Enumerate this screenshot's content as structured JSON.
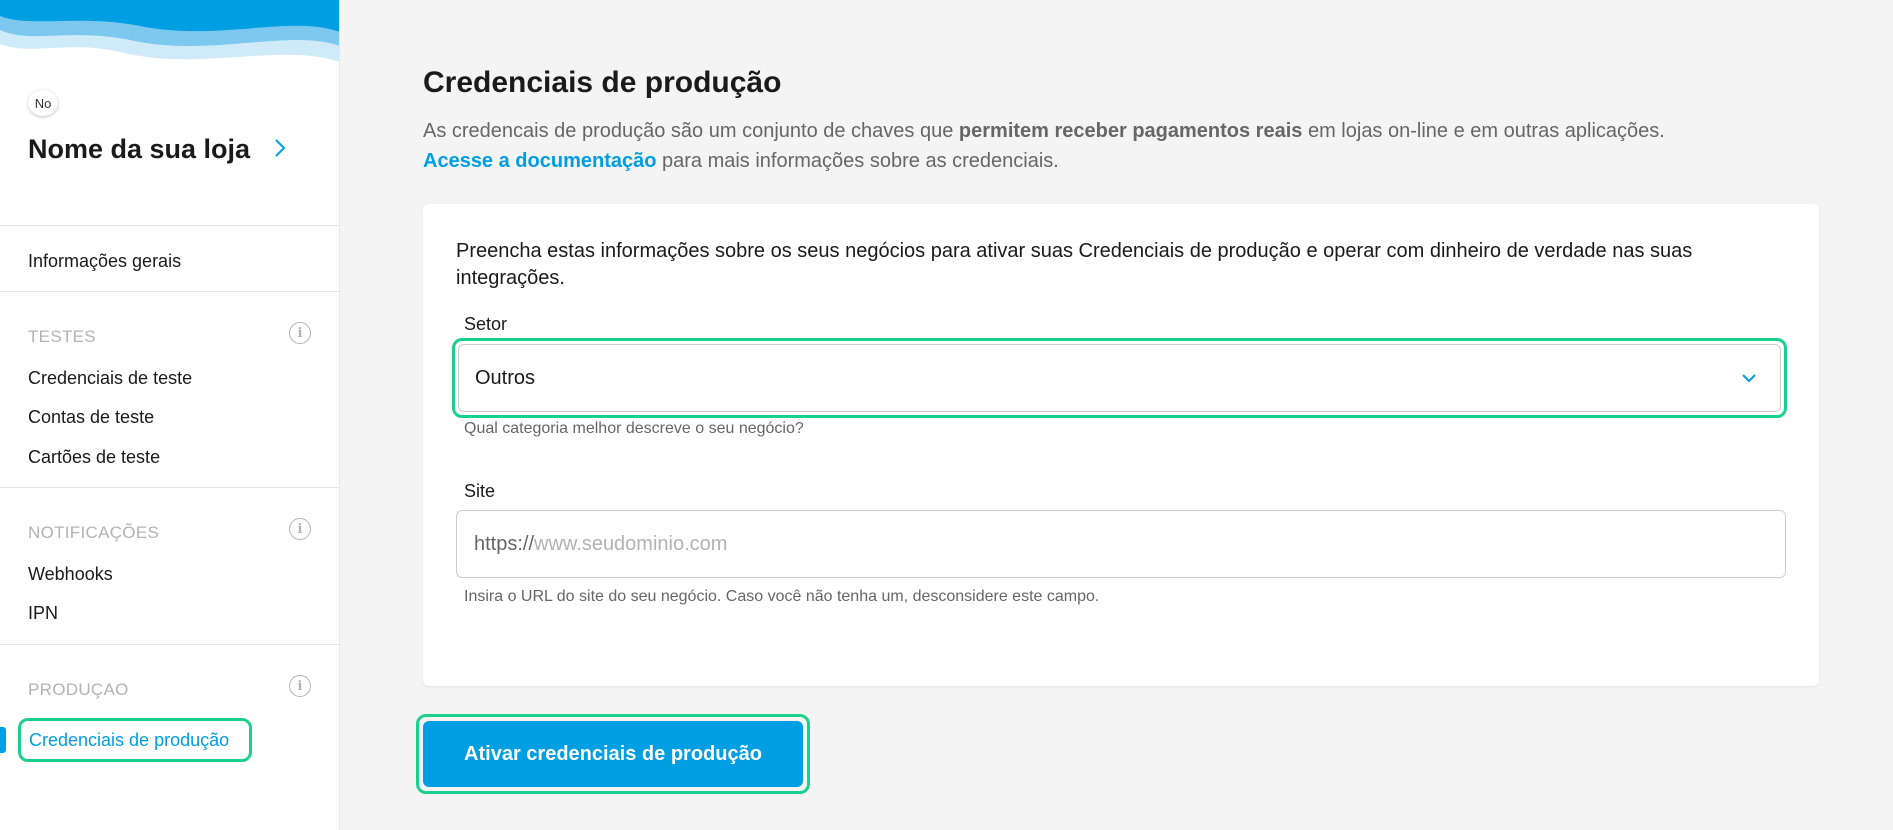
{
  "sidebar": {
    "avatar_initials": "No",
    "store_name": "Nome da sua loja",
    "general_info": "Informações gerais",
    "sections": [
      {
        "title": "TESTES",
        "items": [
          "Credenciais de teste",
          "Contas de teste",
          "Cartões de teste"
        ]
      },
      {
        "title": "NOTIFICAÇÕES",
        "items": [
          "Webhooks",
          "IPN"
        ]
      },
      {
        "title": "PRODUÇAO",
        "items": [
          "Credenciais de produção"
        ]
      }
    ],
    "info_glyph": "i"
  },
  "main": {
    "title": "Credenciais de produção",
    "desc_part1": "As credencais de produção são um conjunto de chaves que ",
    "desc_bold": "permitem receber pagamentos reais",
    "desc_part2": " em lojas on-line e em outras aplicações.",
    "doc_link": "Acesse a documentação",
    "desc_part3": " para mais informações sobre as credenciais.",
    "card": {
      "intro": "Preencha estas informações sobre os seus negócios para ativar suas Credenciais de produção e operar com dinheiro de verdade nas suas integrações.",
      "sector": {
        "label": "Setor",
        "value": "Outros",
        "help": "Qual categoria melhor descreve o seu negócio?"
      },
      "site": {
        "label": "Site",
        "prefix": "https://",
        "placeholder": "www.seudominio.com",
        "help": "Insira o URL do site do seu negócio. Caso você não tenha um, desconsidere este campo."
      }
    },
    "activate_button": "Ativar credenciais de produção"
  },
  "colors": {
    "accent": "#009ee3",
    "highlight": "#19d08d"
  }
}
